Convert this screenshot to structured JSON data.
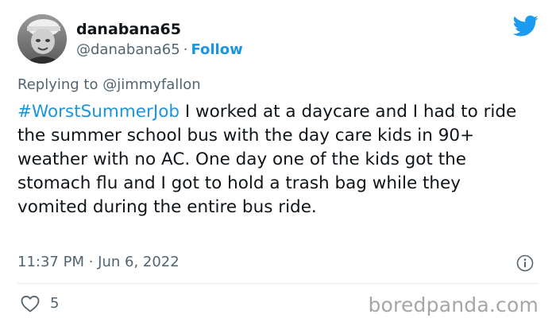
{
  "tweet": {
    "display_name": "danabana65",
    "handle": "@danabana65",
    "separator": "·",
    "follow_label": "Follow",
    "reply_label": "Replying to @jimmyfallon",
    "hashtag": "#WorstSummerJob",
    "body": " I worked at a daycare and I had to ride the summer school bus with the day care kids in 90+ weather with no AC. One day one of the kids got the stomach flu and I got to hold a trash bag while they vomited during the entire bus ride.",
    "timestamp": "11:37 PM · Jun 6, 2022",
    "like_count": "5"
  },
  "watermark": "boredpanda.com",
  "icons": {
    "brand": "twitter-bird-icon",
    "info": "info-icon",
    "like": "heart-icon"
  },
  "colors": {
    "accent": "#1b95e0",
    "text": "#0f1419",
    "muted": "#536471",
    "watermark": "#a6a6a6"
  }
}
